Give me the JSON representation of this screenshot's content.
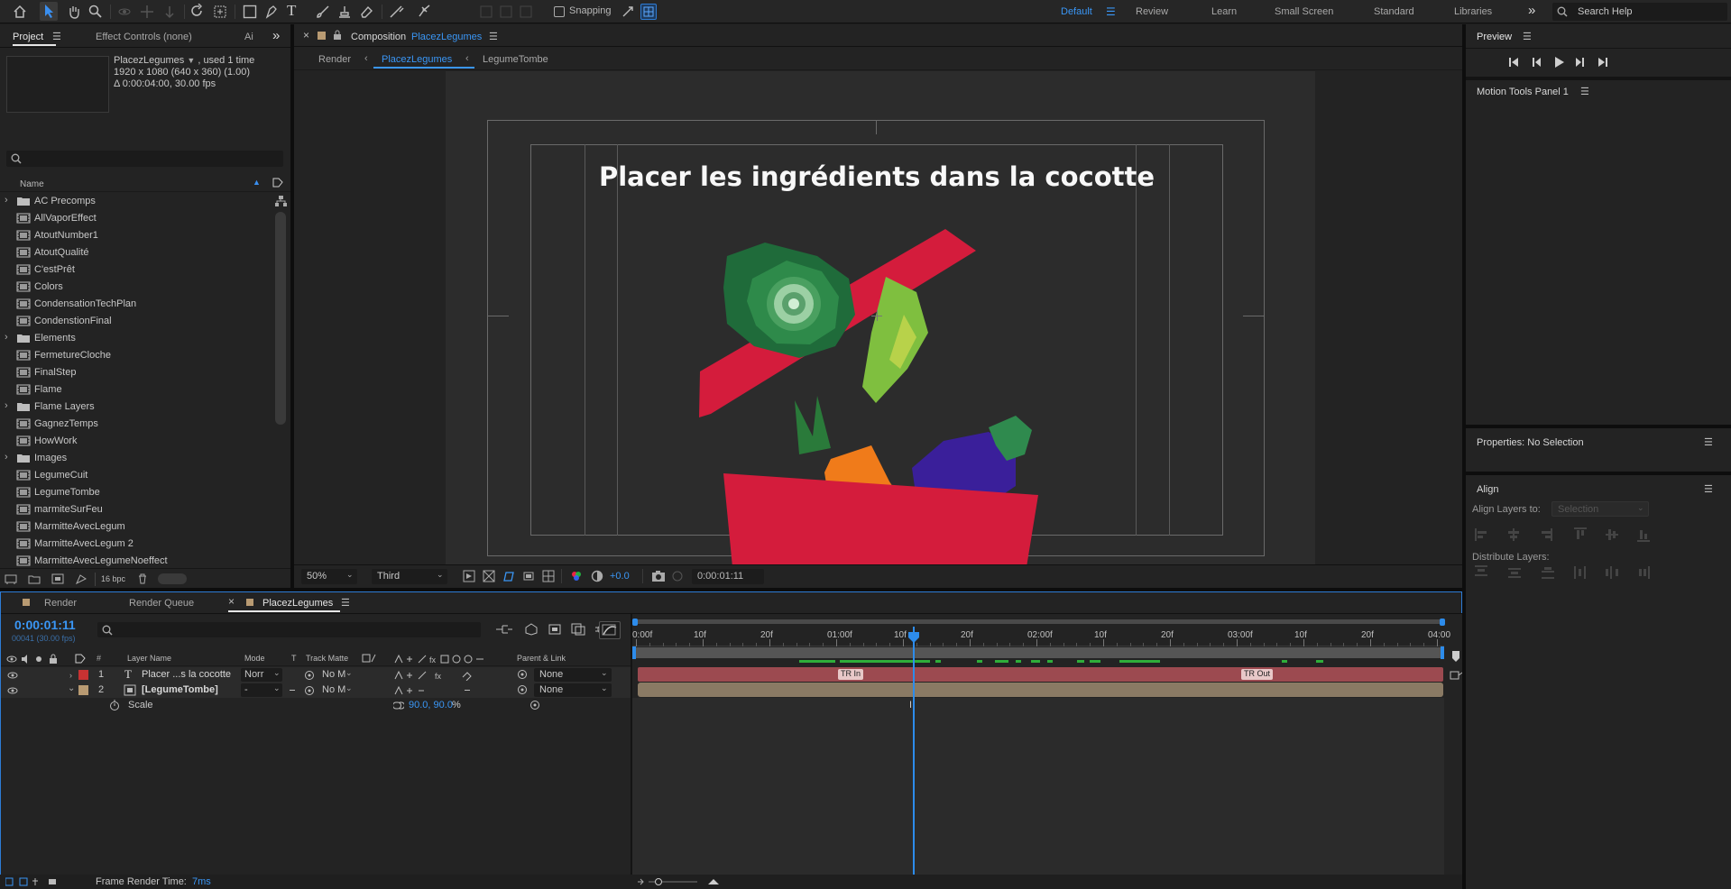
{
  "toolbar": {
    "snapping_label": "Snapping",
    "workspaces": [
      "Default",
      "Review",
      "Learn",
      "Small Screen",
      "Standard",
      "Libraries"
    ],
    "search_placeholder": "Search Help"
  },
  "project_panel": {
    "tab_project": "Project",
    "tab_effect_controls": "Effect Controls (none)",
    "tab_overflow": "Ai",
    "selected_name": "PlacezLegumes",
    "used_info": ", used 1 time",
    "dims": "1920 x 1080  (640 x 360) (1.00)",
    "duration": "Δ 0:00:04:00, 30.00 fps",
    "search_placeholder": "",
    "column_name": "Name",
    "items": [
      {
        "name": "AC Precomps",
        "type": "folder"
      },
      {
        "name": "AllVaporEffect",
        "type": "comp"
      },
      {
        "name": "AtoutNumber1",
        "type": "comp"
      },
      {
        "name": "AtoutQualité",
        "type": "comp"
      },
      {
        "name": "C'estPrêt",
        "type": "comp"
      },
      {
        "name": "Colors",
        "type": "comp"
      },
      {
        "name": "CondensationTechPlan",
        "type": "comp"
      },
      {
        "name": "CondenstionFinal",
        "type": "comp"
      },
      {
        "name": "Elements",
        "type": "folder"
      },
      {
        "name": "FermetureCloche",
        "type": "comp"
      },
      {
        "name": "FinalStep",
        "type": "comp"
      },
      {
        "name": "Flame",
        "type": "comp"
      },
      {
        "name": "Flame Layers",
        "type": "folder"
      },
      {
        "name": "GagnezTemps",
        "type": "comp"
      },
      {
        "name": "HowWork",
        "type": "comp"
      },
      {
        "name": "Images",
        "type": "folder"
      },
      {
        "name": "LegumeCuit",
        "type": "comp"
      },
      {
        "name": "LegumeTombe",
        "type": "comp"
      },
      {
        "name": "marmiteSurFeu",
        "type": "comp"
      },
      {
        "name": "MarmitteAvecLegum",
        "type": "comp"
      },
      {
        "name": "MarmitteAvecLegum 2",
        "type": "comp"
      },
      {
        "name": "MarmitteAvecLegumeNoeffect",
        "type": "comp"
      }
    ],
    "bpc": "16 bpc"
  },
  "composition": {
    "panel_label": "Composition",
    "comp_name": "PlacezLegumes",
    "breadcrumbs": [
      "Render",
      "PlacezLegumes",
      "LegumeTombe"
    ],
    "title_text": "Placer les ingrédients dans la cocotte",
    "zoom": "50%",
    "resolution": "Third",
    "exposure": "+0.0",
    "timecode": "0:00:01:11"
  },
  "right_panels": {
    "preview_title": "Preview",
    "motion_tools_title": "Motion Tools Panel 1",
    "properties_title": "Properties: No Selection",
    "align_title": "Align",
    "align_layers_to": "Align Layers to:",
    "align_selection": "Selection",
    "distribute_layers": "Distribute Layers:"
  },
  "timeline": {
    "tabs": [
      "Render",
      "Render Queue",
      "PlacezLegumes"
    ],
    "current_time": "0:00:01:11",
    "frame_info": "00041 (30.00 fps)",
    "headers": {
      "layer_name": "Layer Name",
      "mode": "Mode",
      "t": "T",
      "track_matte": "Track Matte",
      "parent": "Parent & Link"
    },
    "layers": [
      {
        "num": "1",
        "name": "Placer ...s la cocotte",
        "mode": "Norr",
        "matte": "No M",
        "parent": "None",
        "color": "#c83232",
        "kind": "text"
      },
      {
        "num": "2",
        "name": "[LegumeTombe]",
        "mode": "-",
        "matte": "No M",
        "parent": "None",
        "color": "#b89a72",
        "kind": "comp"
      }
    ],
    "property": {
      "name": "Scale",
      "value": "90.0, 90.0",
      "unit": "%"
    },
    "ruler_labels": [
      "0:00f",
      "10f",
      "20f",
      "01:00f",
      "10f",
      "20f",
      "02:00f",
      "10f",
      "20f",
      "03:00f",
      "10f",
      "20f",
      "04:00"
    ],
    "markers": [
      "TR In",
      "TR Out"
    ],
    "render_time_label": "Frame Render Time:",
    "render_time_value": "7ms"
  }
}
